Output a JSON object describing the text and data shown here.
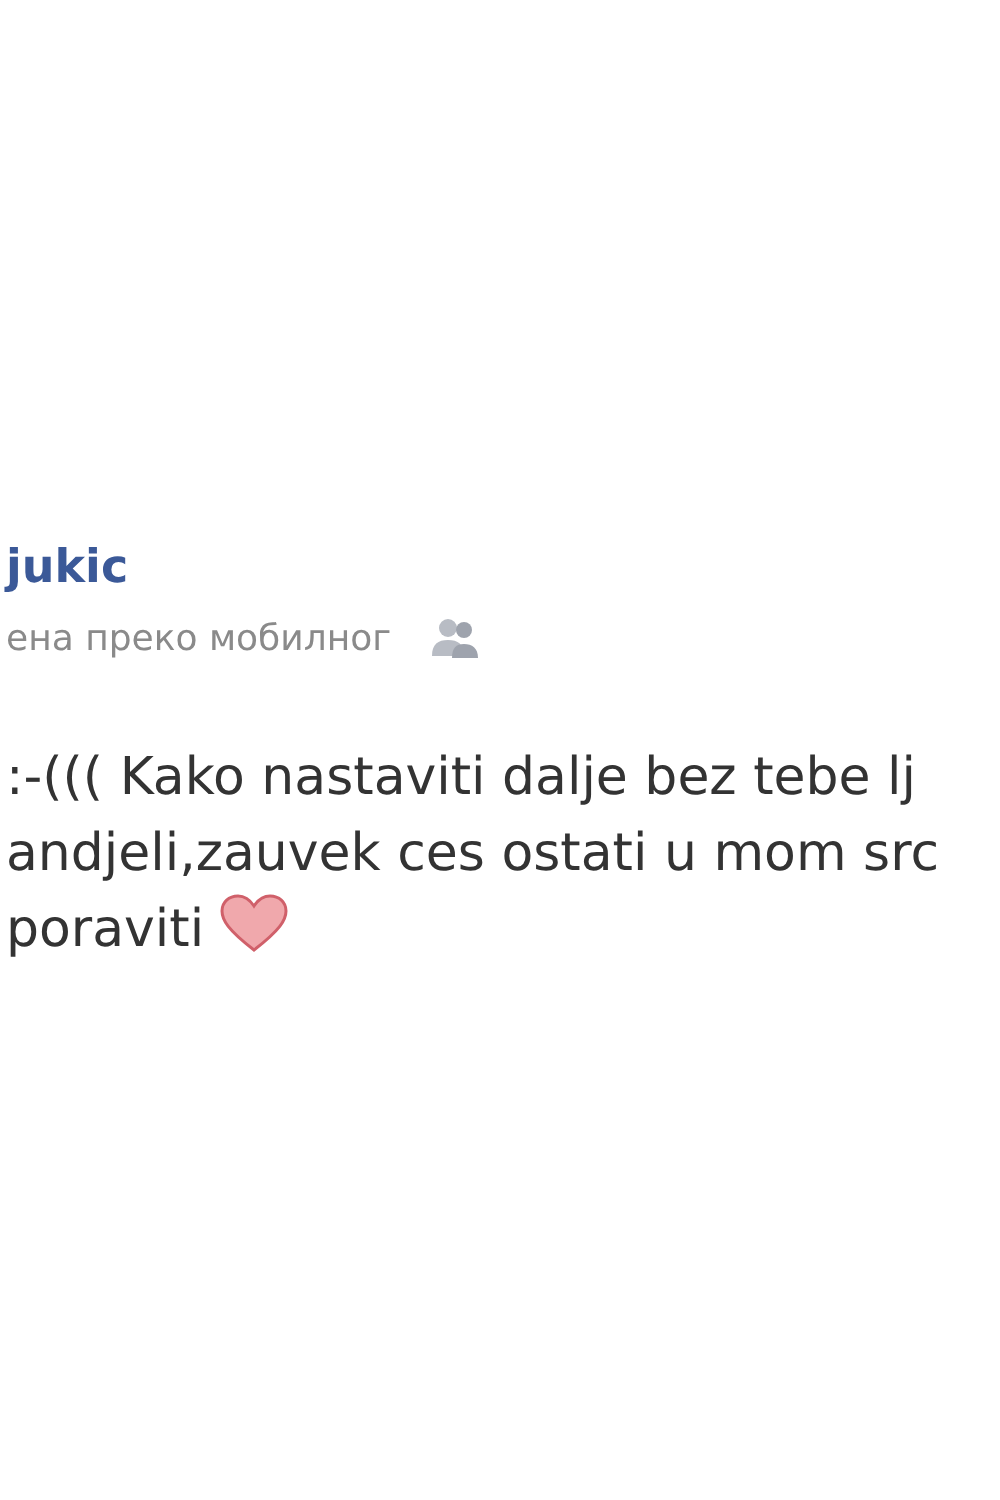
{
  "post": {
    "author": "jukic",
    "subtitle": "ена преко мобилног",
    "message_lines": [
      ":-((( Kako nastaviti dalje bez tebe lj",
      "andjeli,zauvek ces ostati u mom src",
      "poraviti"
    ]
  }
}
